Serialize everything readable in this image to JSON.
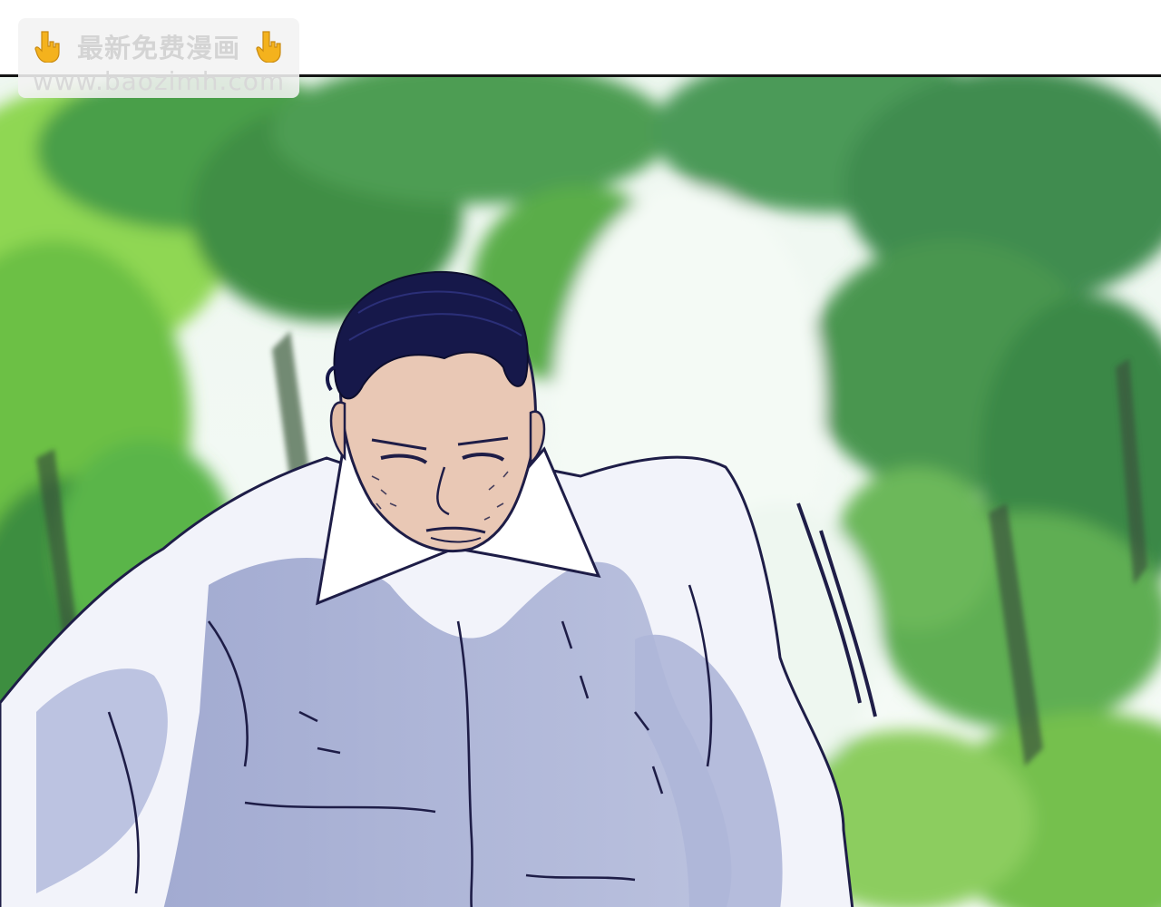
{
  "watermark": {
    "title": "最新免费漫画",
    "url": "www.baozimh.com",
    "left_icon": "pointing-down-hand-icon",
    "right_icon": "pointing-down-hand-icon"
  },
  "scene": {
    "character": "man in white shirt with slicked-back dark hair",
    "background": "blurred green trees"
  },
  "colors": {
    "hair": "#16184a",
    "shirt": "#f3f4fb",
    "shirt_shadow": "#a9b1d3",
    "skin": "#e9c8b5",
    "outline": "#1e1d47",
    "foliage_light": "#7fd24e",
    "foliage_dark": "#2f7a3c",
    "sky": "#f2f8f4",
    "hand_icon": "#f4b21d"
  }
}
